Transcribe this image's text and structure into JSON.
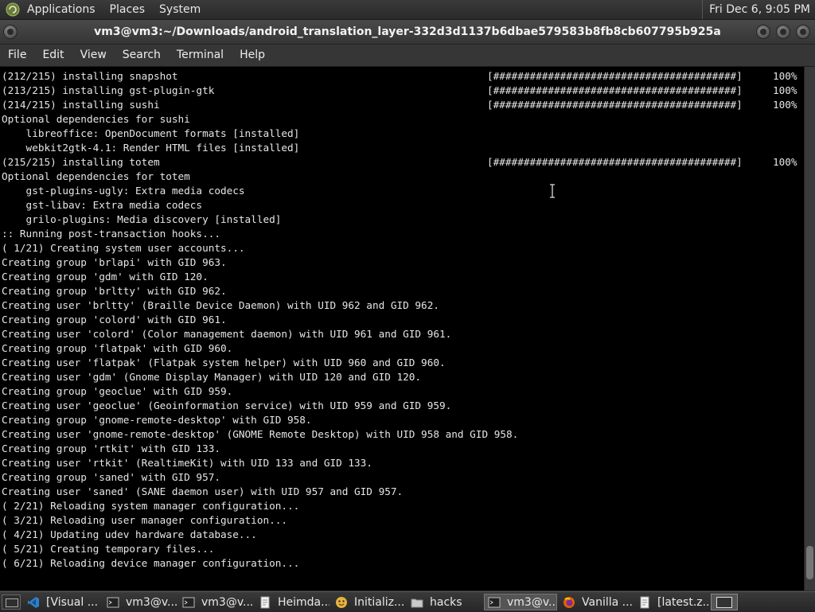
{
  "top_panel": {
    "menus": [
      "Applications",
      "Places",
      "System"
    ],
    "clock": "Fri Dec 6, 9:05 PM"
  },
  "window": {
    "title": "vm3@vm3:~/Downloads/android_translation_layer-332d3d1137b6dbae579583b8fb8cb607795b925a",
    "menu": [
      "File",
      "Edit",
      "View",
      "Search",
      "Terminal",
      "Help"
    ]
  },
  "terminal": {
    "lines": [
      {
        "text": "(212/215) installing snapshot",
        "bar": "[########################################]",
        "pct": "100%"
      },
      {
        "text": "(213/215) installing gst-plugin-gtk",
        "bar": "[########################################]",
        "pct": "100%"
      },
      {
        "text": "(214/215) installing sushi",
        "bar": "[########################################]",
        "pct": "100%"
      },
      {
        "text": "Optional dependencies for sushi"
      },
      {
        "text": "    libreoffice: OpenDocument formats [installed]"
      },
      {
        "text": "    webkit2gtk-4.1: Render HTML files [installed]"
      },
      {
        "text": "(215/215) installing totem",
        "bar": "[########################################]",
        "pct": "100%"
      },
      {
        "text": "Optional dependencies for totem"
      },
      {
        "text": "    gst-plugins-ugly: Extra media codecs"
      },
      {
        "text": "    gst-libav: Extra media codecs"
      },
      {
        "text": "    grilo-plugins: Media discovery [installed]"
      },
      {
        "text": ":: Running post-transaction hooks..."
      },
      {
        "text": "( 1/21) Creating system user accounts..."
      },
      {
        "text": "Creating group 'brlapi' with GID 963."
      },
      {
        "text": "Creating group 'gdm' with GID 120."
      },
      {
        "text": "Creating group 'brltty' with GID 962."
      },
      {
        "text": "Creating user 'brltty' (Braille Device Daemon) with UID 962 and GID 962."
      },
      {
        "text": "Creating group 'colord' with GID 961."
      },
      {
        "text": "Creating user 'colord' (Color management daemon) with UID 961 and GID 961."
      },
      {
        "text": "Creating group 'flatpak' with GID 960."
      },
      {
        "text": "Creating user 'flatpak' (Flatpak system helper) with UID 960 and GID 960."
      },
      {
        "text": "Creating user 'gdm' (Gnome Display Manager) with UID 120 and GID 120."
      },
      {
        "text": "Creating group 'geoclue' with GID 959."
      },
      {
        "text": "Creating user 'geoclue' (Geoinformation service) with UID 959 and GID 959."
      },
      {
        "text": "Creating group 'gnome-remote-desktop' with GID 958."
      },
      {
        "text": "Creating user 'gnome-remote-desktop' (GNOME Remote Desktop) with UID 958 and GID 958."
      },
      {
        "text": "Creating group 'rtkit' with GID 133."
      },
      {
        "text": "Creating user 'rtkit' (RealtimeKit) with UID 133 and GID 133."
      },
      {
        "text": "Creating group 'saned' with GID 957."
      },
      {
        "text": "Creating user 'saned' (SANE daemon user) with UID 957 and GID 957."
      },
      {
        "text": "( 2/21) Reloading system manager configuration..."
      },
      {
        "text": "( 3/21) Reloading user manager configuration..."
      },
      {
        "text": "( 4/21) Updating udev hardware database..."
      },
      {
        "text": "( 5/21) Creating temporary files..."
      },
      {
        "text": "( 6/21) Reloading device manager configuration..."
      }
    ]
  },
  "taskbar": {
    "items": [
      {
        "icon": "vscode-icon",
        "label": "[Visual ...",
        "active": false
      },
      {
        "icon": "terminal-icon",
        "label": "vm3@v...",
        "active": false
      },
      {
        "icon": "terminal-icon",
        "label": "vm3@v...",
        "active": false
      },
      {
        "icon": "document-icon",
        "label": "Heimda...",
        "active": false
      },
      {
        "icon": "installer-icon",
        "label": "Initializ...",
        "active": false
      },
      {
        "icon": "folder-icon",
        "label": "hacks",
        "active": false
      },
      {
        "icon": "terminal-icon",
        "label": "vm3@v...",
        "active": true
      },
      {
        "icon": "firefox-icon",
        "label": "Vanilla ...",
        "active": false
      },
      {
        "icon": "document-icon",
        "label": "[latest.z...",
        "active": false
      }
    ]
  },
  "colors": {
    "terminal_bg": "#000000",
    "terminal_fg": "#e6e6e6",
    "panel_bg": "#2f2f2f"
  }
}
